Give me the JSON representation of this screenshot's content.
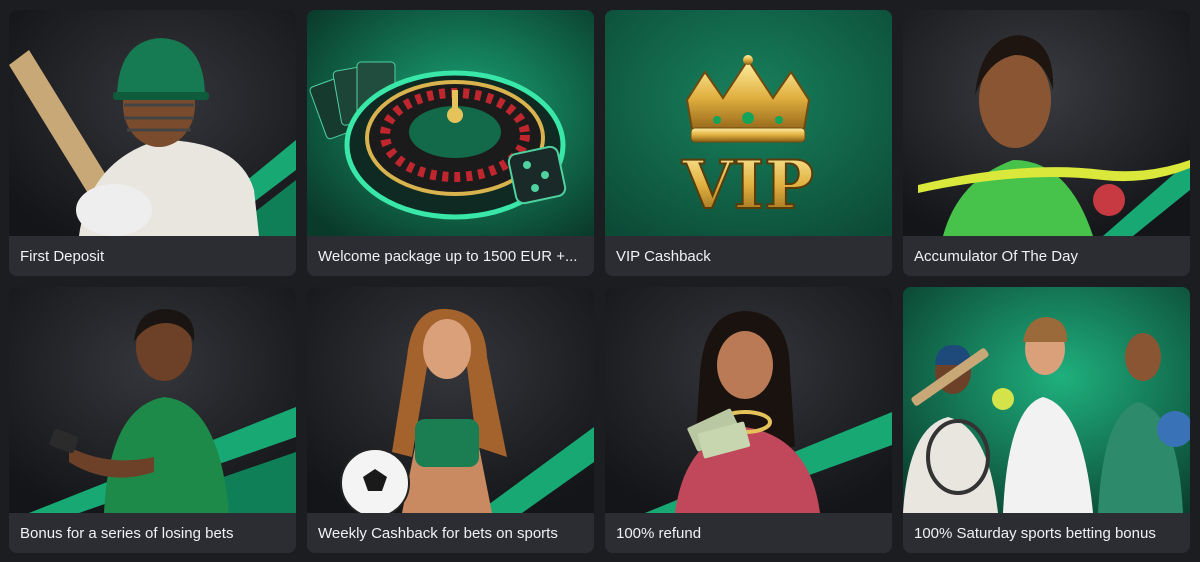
{
  "promotions": [
    {
      "title": "First Deposit",
      "image": "cricket-batsman"
    },
    {
      "title": "Welcome package up to 1500 EUR +...",
      "image": "casino-roulette"
    },
    {
      "title": "VIP Cashback",
      "image": "vip-crown",
      "vip_label": "VIP"
    },
    {
      "title": "Accumulator Of The Day",
      "image": "sprinter-finish-line"
    },
    {
      "title": "Bonus for a series of losing bets",
      "image": "man-with-phone"
    },
    {
      "title": "Weekly Cashback for bets on sports",
      "image": "woman-with-football"
    },
    {
      "title": "100% refund",
      "image": "woman-with-banknotes"
    },
    {
      "title": "100% Saturday sports betting bonus",
      "image": "athletes-group"
    }
  ],
  "colors": {
    "background": "#1c1d21",
    "card": "#2b2d33",
    "accent": "#17b07a",
    "text": "#f1f1f3"
  }
}
